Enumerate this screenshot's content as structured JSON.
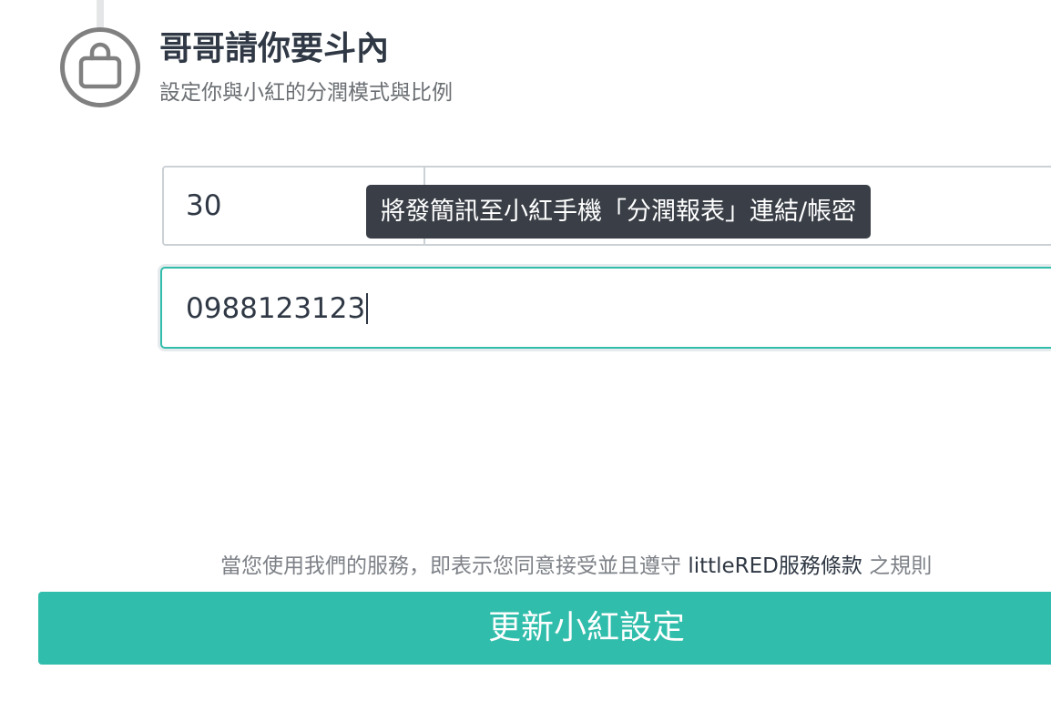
{
  "step": {
    "icon": "shopping-bag-icon",
    "title": "哥哥請你要斗內",
    "subtitle": "設定你與小紅的分潤模式與比例"
  },
  "split": {
    "ratio_value": "30",
    "tooltip": "將發簡訊至小紅手機「分潤報表」連結/帳密"
  },
  "phone": {
    "value": "0988123123"
  },
  "terms": {
    "prefix": "當您使用我們的服務，即表示您同意接受並且遵守 ",
    "link": "littleRED服務條款",
    "suffix": " 之規則"
  },
  "submit_label": "更新小紅設定",
  "colors": {
    "accent": "#31bdab",
    "title": "#2f3844",
    "muted": "#6b6f73",
    "tooltip_bg": "#3a3f47"
  }
}
